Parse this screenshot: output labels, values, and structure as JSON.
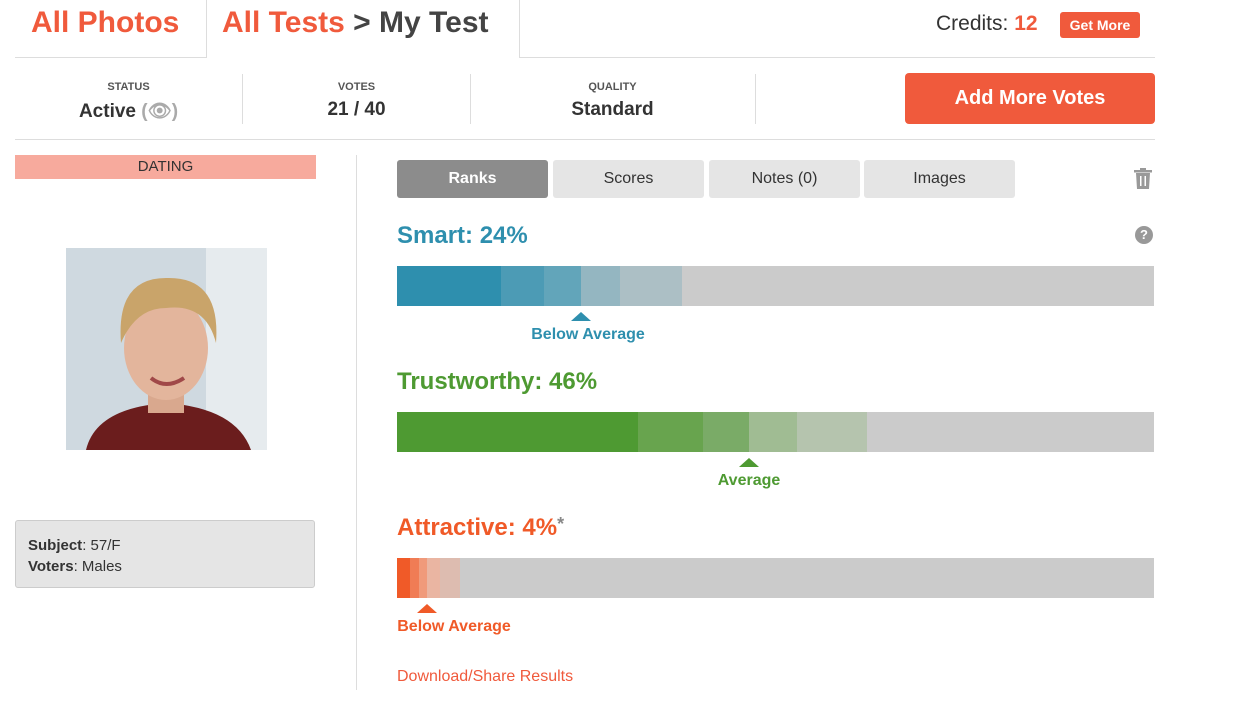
{
  "header": {
    "all_photos": "All Photos",
    "all_tests": "All Tests",
    "separator": ">",
    "test_name": "My Test",
    "credits_label": "Credits:",
    "credits_value": "12",
    "get_more": "Get More"
  },
  "stats": [
    {
      "label": "STATUS",
      "value": "Active"
    },
    {
      "label": "VOTES",
      "value": "21 / 40"
    },
    {
      "label": "QUALITY",
      "value": "Standard"
    }
  ],
  "status_icon": "eye-icon",
  "add_votes": "Add More Votes",
  "category": "DATING",
  "subject": {
    "subject_label": "Subject",
    "subject_value": ": 57/F",
    "voters_label": "Voters",
    "voters_value": ": Males"
  },
  "tabs": [
    {
      "label": "Ranks",
      "active": true
    },
    {
      "label": "Scores"
    },
    {
      "label": "Notes (0)"
    },
    {
      "label": "Images"
    }
  ],
  "metrics": [
    {
      "title": "Smart: 24%",
      "percent": 24,
      "rating": "Below Average",
      "color": "#2e8fae",
      "segments": [
        "#2e8fae",
        "#4c9bb5",
        "#62a5ba",
        "#94b6c1",
        "#acbfc5"
      ]
    },
    {
      "title": "Trustworthy: 46%",
      "percent": 46,
      "rating": "Average",
      "color": "#4e9a32",
      "segments": [
        "#4e9a32",
        "#68a44e",
        "#7aab67",
        "#a0bc93",
        "#b5c4ae"
      ]
    },
    {
      "title": "Attractive: 4%",
      "asterisk": "*",
      "percent": 4,
      "rating": "Below Average",
      "color": "#f05a28",
      "segments": [
        "#f05a28",
        "#f07c55",
        "#f09a7b",
        "#eab5a2",
        "#ddbcb0"
      ]
    }
  ],
  "download": "Download/Share Results"
}
